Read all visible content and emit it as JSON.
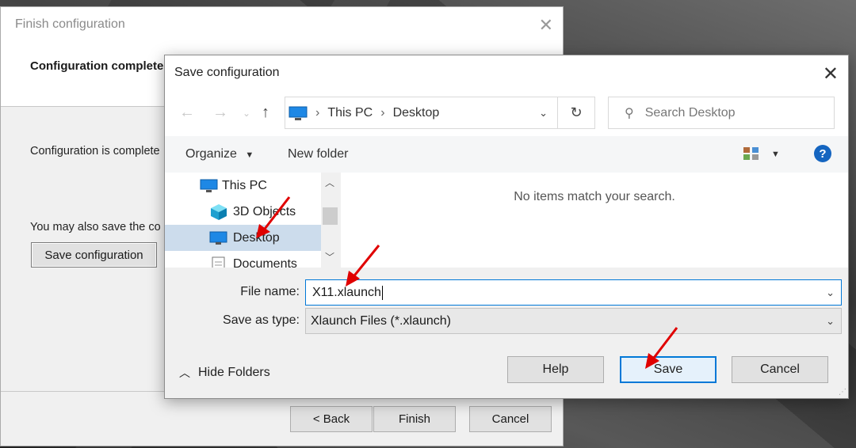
{
  "wizard": {
    "title": "Finish configuration",
    "header": "Configuration complete",
    "body_line1": "Configuration is complete",
    "body_line2": "You may also save the co",
    "save_button": "Save configuration",
    "back_button": "< Back",
    "finish_button": "Finish",
    "cancel_button": "Cancel"
  },
  "dialog": {
    "title": "Save configuration",
    "breadcrumb": [
      "This PC",
      "Desktop"
    ],
    "search_placeholder": "Search Desktop",
    "toolbar": {
      "organize": "Organize",
      "new_folder": "New folder"
    },
    "nav_items": [
      "This PC",
      "3D Objects",
      "Desktop",
      "Documents"
    ],
    "selected_nav": "Desktop",
    "empty_message": "No items match your search.",
    "file_name_label": "File name:",
    "file_name_value": "X11.xlaunch",
    "save_type_label": "Save as type:",
    "save_type_value": "Xlaunch Files (*.xlaunch)",
    "hide_folders": "Hide Folders",
    "help_button": "Help",
    "save_button": "Save",
    "cancel_button": "Cancel"
  },
  "colors": {
    "accent": "#0078d7",
    "annotation_arrow": "#e00000",
    "selection": "#ccdcec"
  },
  "icons": [
    "close-icon",
    "back-arrow-icon",
    "forward-arrow-icon",
    "up-arrow-icon",
    "refresh-icon",
    "search-icon",
    "computer-icon",
    "cube-icon",
    "desktop-icon",
    "document-icon",
    "help-icon",
    "view-icon",
    "chevron-down-icon",
    "chevron-up-icon"
  ]
}
